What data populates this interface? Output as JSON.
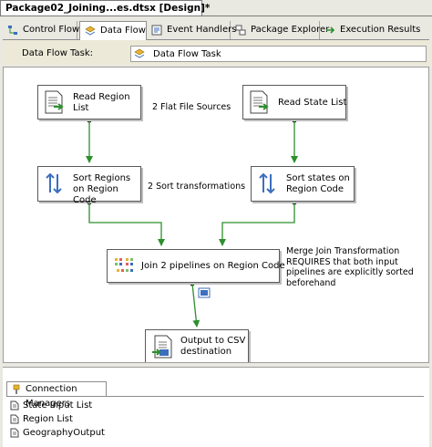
{
  "document": {
    "tab_title": "Package02_Joining...es.dtsx [Design]*"
  },
  "designer_tabs": [
    {
      "label": "Control Flow",
      "icon": "control-flow-icon"
    },
    {
      "label": "Data Flow",
      "icon": "data-flow-icon"
    },
    {
      "label": "Event Handlers",
      "icon": "event-handlers-icon"
    },
    {
      "label": "Package Explorer",
      "icon": "package-explorer-icon"
    },
    {
      "label": "Execution Results",
      "icon": "execution-results-icon"
    }
  ],
  "active_tab": "Data Flow",
  "task_selector": {
    "label": "Data Flow Task:",
    "value": "Data Flow Task"
  },
  "components": {
    "read_region": "Read Region List",
    "read_state": "Read State List",
    "sort_regions": "Sort Regions on Region Code",
    "sort_states": "Sort states on Region Code",
    "join": "Join 2 pipelines on Region Code",
    "output": "Output to CSV destination"
  },
  "annotations": {
    "sources": "2 Flat File Sources",
    "sorts": "2 Sort transformations",
    "merge_join": "Merge Join Transformation REQUIRES that both input pipelines are explicitly sorted beforehand"
  },
  "connection_managers": {
    "tab_label": "Connection Managers",
    "items": [
      "State Input List",
      "Region List",
      "GeographyOutput"
    ]
  },
  "colors": {
    "flow_arrow": "#2d8f2d",
    "canvas": "#ffffff",
    "chrome": "#ece9d8"
  }
}
